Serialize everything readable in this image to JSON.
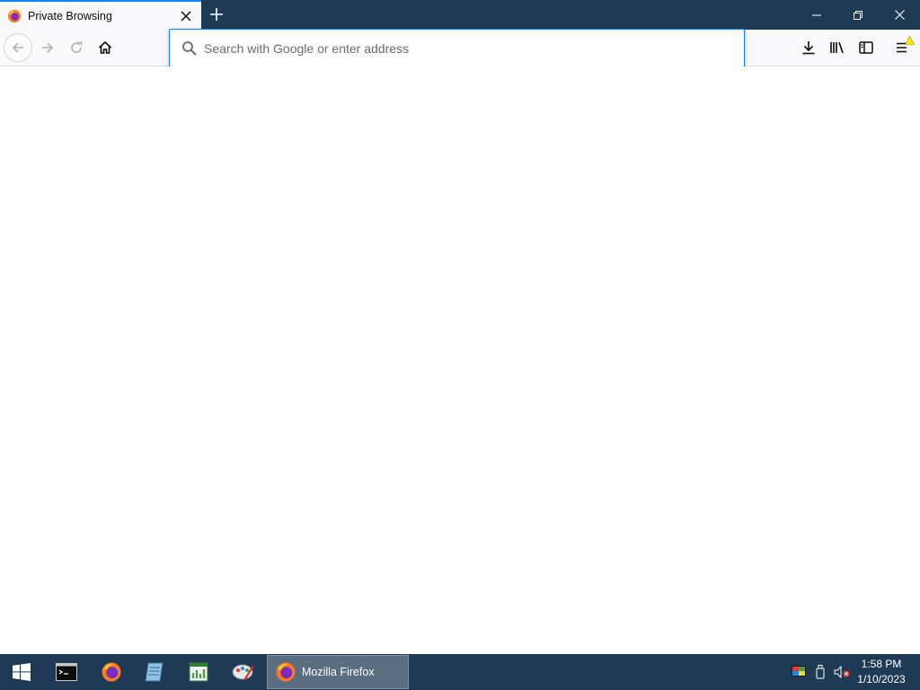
{
  "browser": {
    "tab": {
      "title": "Private Browsing"
    },
    "urlbar": {
      "placeholder": "Search with Google or enter address",
      "value": ""
    },
    "accent_color": "#0a84ff",
    "chrome_color": "#1f3a55"
  },
  "icons": {
    "tab_favicon": "firefox-icon",
    "tab_close": "close-icon",
    "new_tab": "plus-icon",
    "minimize": "minimize-icon",
    "restore": "restore-icon",
    "close_window": "close-icon",
    "back": "arrow-left-icon",
    "forward": "arrow-right-icon",
    "reload": "reload-icon",
    "home": "home-icon",
    "search": "search-icon",
    "downloads": "download-icon",
    "library": "library-icon",
    "sidebar": "sidebar-icon",
    "menu": "hamburger-menu-icon",
    "menu_alert": "warning-icon"
  },
  "taskbar": {
    "pinned": [
      "start-icon",
      "terminal-icon",
      "firefox-icon",
      "notepad-icon",
      "spreadsheet-icon",
      "paint-icon"
    ],
    "active_app": {
      "label": "Mozilla Firefox"
    },
    "tray": [
      "color-display-icon",
      "usb-icon",
      "muted-speaker-icon"
    ],
    "clock": {
      "time": "1:58 PM",
      "date": "1/10/2023"
    }
  }
}
